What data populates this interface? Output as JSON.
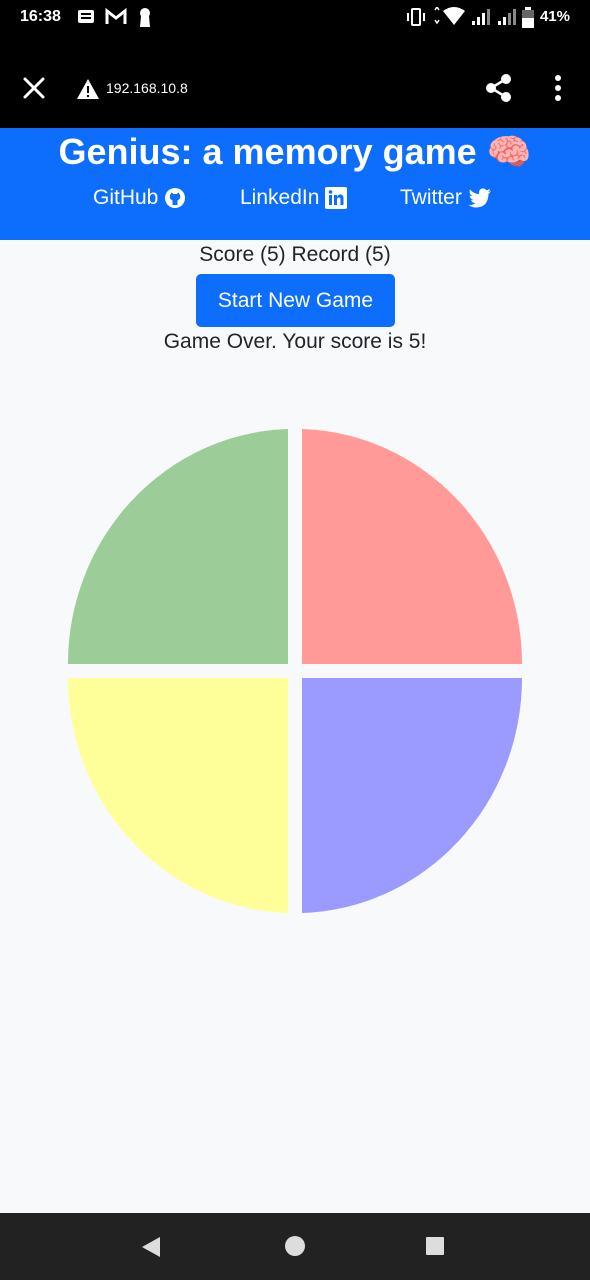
{
  "status_bar": {
    "time": "16:38",
    "battery": "41%"
  },
  "browser": {
    "url": "192.168.10.8"
  },
  "header": {
    "title": "Genius: a memory game 🧠",
    "links": [
      {
        "label": "GitHub",
        "icon": "github-icon"
      },
      {
        "label": "LinkedIn",
        "icon": "linkedin-icon"
      },
      {
        "label": "Twitter",
        "icon": "twitter-icon"
      }
    ]
  },
  "game": {
    "score_line": "Score (5) Record (5)",
    "start_button": "Start New Game",
    "status_message": "Game Over. Your score is 5!",
    "quadrants": [
      {
        "name": "green",
        "color": "#9ccc98"
      },
      {
        "name": "red",
        "color": "#ff9a98"
      },
      {
        "name": "yellow",
        "color": "#ffff9a"
      },
      {
        "name": "blue",
        "color": "#9a9aff"
      }
    ]
  },
  "colors": {
    "primary": "#0d6efd",
    "page_background": "#f8f9fa"
  }
}
